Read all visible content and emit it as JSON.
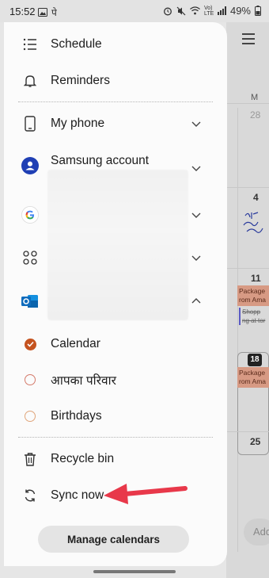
{
  "status_bar": {
    "time": "15:52",
    "left_extra": "पे",
    "signal_text": "Vo) LTE",
    "battery": "49%"
  },
  "drawer": {
    "items": [
      {
        "label": "Schedule",
        "icon": "list-icon"
      },
      {
        "label": "Reminders",
        "icon": "bell-icon"
      }
    ],
    "accounts": [
      {
        "label": "My phone",
        "icon": "phone-icon",
        "expanded": false
      },
      {
        "label": "Samsung account",
        "icon": "samsung-account-icon",
        "expanded": false
      },
      {
        "label": "",
        "icon": "google-icon",
        "expanded": false
      },
      {
        "label": "",
        "icon": "apps-grid-icon",
        "expanded": false
      },
      {
        "label": "",
        "icon": "outlook-icon",
        "expanded": true
      }
    ],
    "calendars": [
      {
        "label": "Calendar",
        "checked": true,
        "color": "#c5531f"
      },
      {
        "label": "आपका परिवार",
        "checked": false,
        "color": "#d47a6a"
      },
      {
        "label": "Birthdays",
        "checked": false,
        "color": "#e0a57a"
      }
    ],
    "actions": [
      {
        "label": "Recycle bin",
        "icon": "trash-icon"
      },
      {
        "label": "Sync now",
        "icon": "sync-icon"
      }
    ],
    "manage_label": "Manage calendars"
  },
  "background_calendar": {
    "weekday": "M",
    "days": [
      "28",
      "4",
      "11",
      "18",
      "25"
    ],
    "events": [
      "Package rom Ama",
      "Package rom Ama"
    ],
    "struck_event": "Shopp ng at tor",
    "add_hint": "Add"
  },
  "colors": {
    "accent": "#c5531f",
    "annotation_arrow": "#e8384a"
  }
}
